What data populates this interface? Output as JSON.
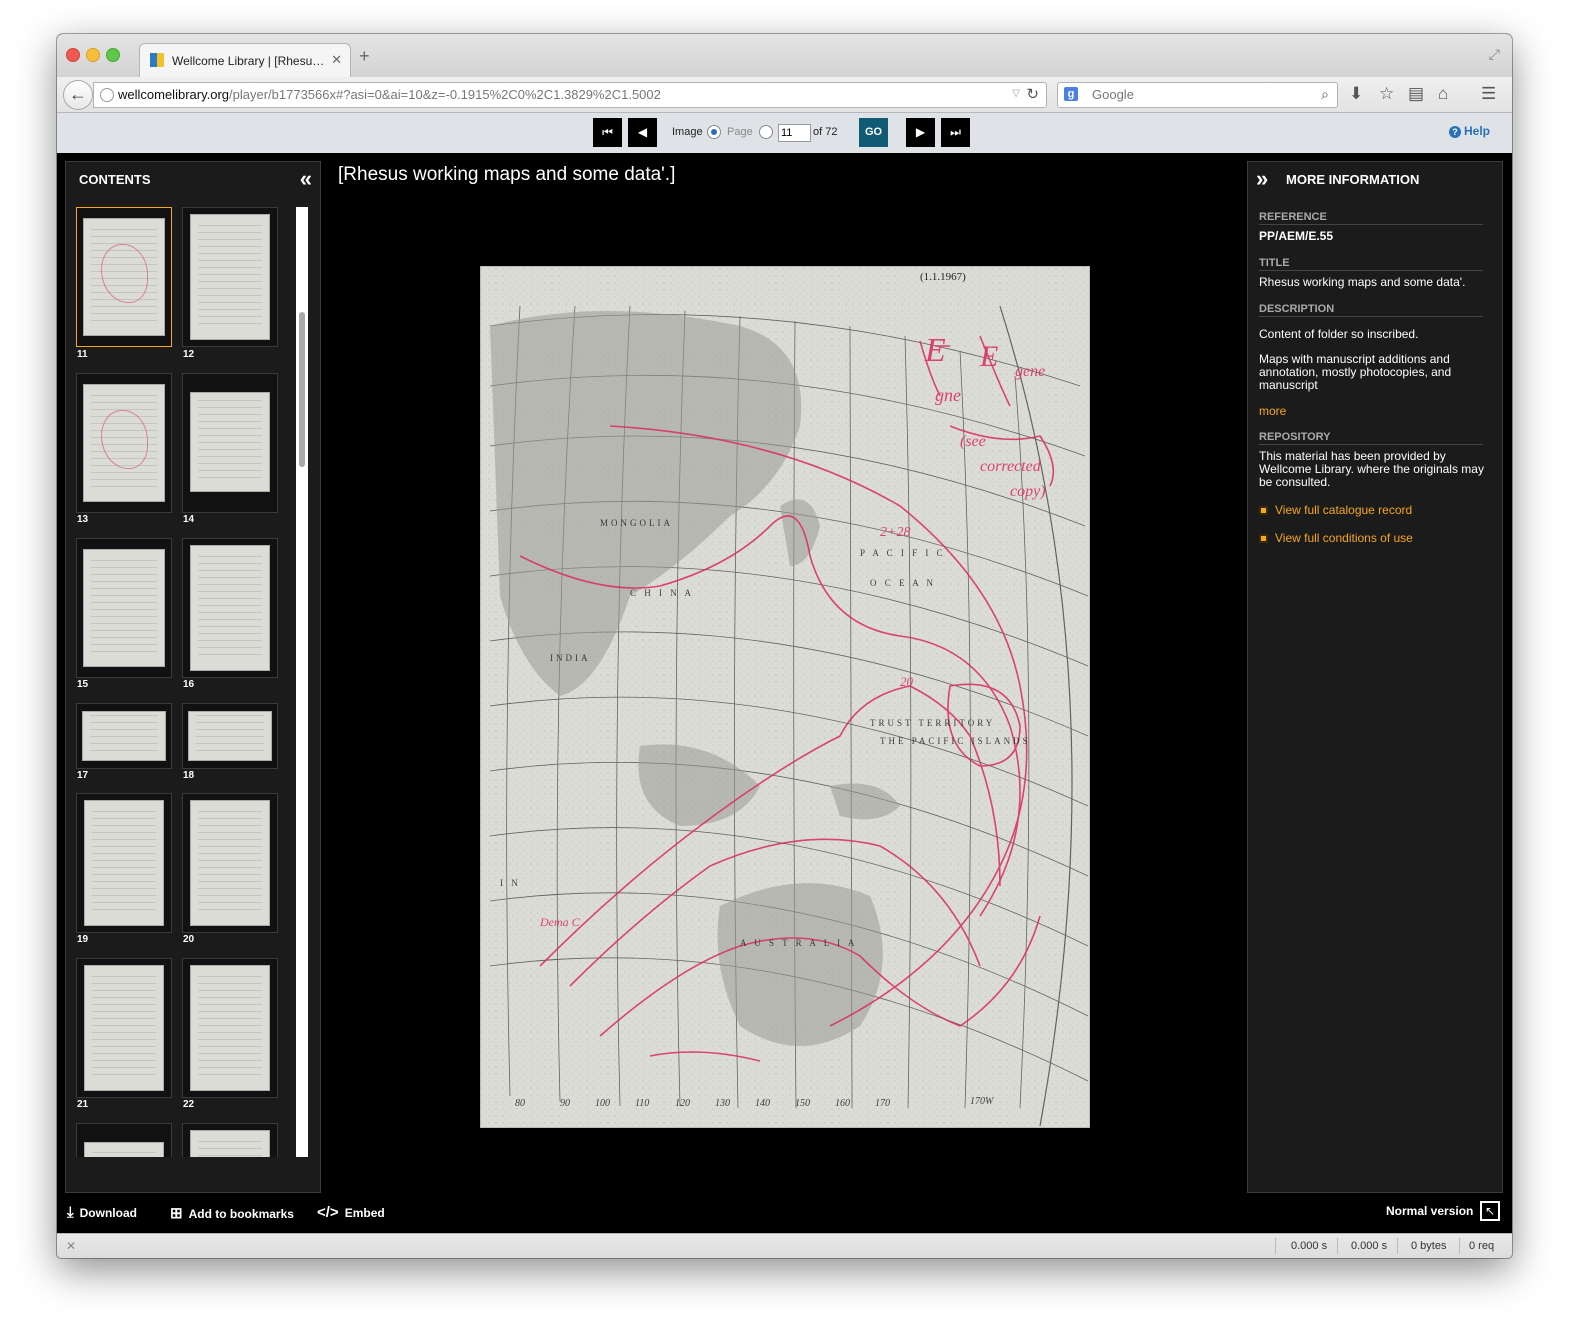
{
  "browser": {
    "tab_title": "Wellcome Library | [Rhesu…",
    "url_host": "wellcomelibrary.org",
    "url_path": "/player/b1773566x#?asi=0&ai=10&z=-0.1915%2C0%2C1.3829%2C1.5002",
    "search_placeholder": "Google"
  },
  "toolbar": {
    "image_label": "Image",
    "page_label": "Page",
    "page_value": "11",
    "of_total": "of 72",
    "go_label": "GO",
    "help_label": "Help"
  },
  "contents": {
    "title": "CONTENTS",
    "thumbs": [
      "11",
      "12",
      "13",
      "14",
      "15",
      "16",
      "17",
      "18",
      "19",
      "20",
      "21",
      "22"
    ]
  },
  "main": {
    "title": "[Rhesus working maps and some data'.]",
    "map_date": "(1.1.1967)"
  },
  "info": {
    "title": "MORE INFORMATION",
    "reference_label": "REFERENCE",
    "reference_value": "PP/AEM/E.55",
    "title_label": "TITLE",
    "title_value": "Rhesus working maps and some data'.",
    "description_label": "DESCRIPTION",
    "description_1": "Content of folder so inscribed.",
    "description_2": "Maps with manuscript additions and annotation, mostly photocopies, and manuscript",
    "more_label": "more",
    "repository_label": "REPOSITORY",
    "repository_value": "This material has been provided by Wellcome Library. where the originals may be consulted.",
    "link_catalogue": "View full catalogue record",
    "link_conditions": "View full conditions of use"
  },
  "footer": {
    "download": "Download",
    "bookmarks": "Add to bookmarks",
    "embed": "Embed",
    "normal_version": "Normal version"
  },
  "status": {
    "time1": "0.000 s",
    "time2": "0.000 s",
    "bytes": "0 bytes",
    "req": "0 req"
  },
  "colors": {
    "accent": "#f5a71d",
    "go_button": "#115a75",
    "help_blue": "#2b70b7",
    "annotation_red": "#d9345e"
  }
}
